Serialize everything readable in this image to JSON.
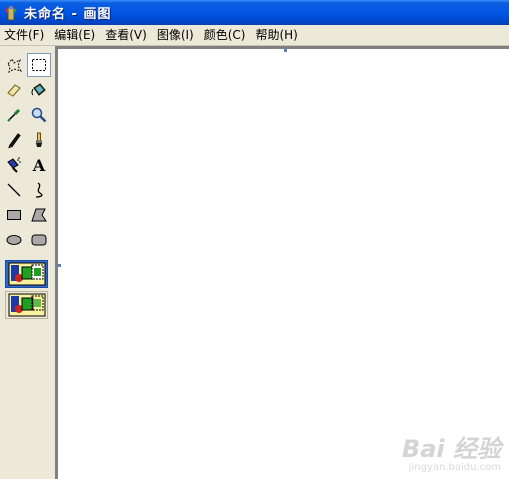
{
  "window": {
    "title": "未命名 - 画图"
  },
  "menu": [
    "文件(F)",
    "编辑(E)",
    "查看(V)",
    "图像(I)",
    "颜色(C)",
    "帮助(H)"
  ],
  "tools": [
    {
      "name": "free-form-select-icon",
      "selected": false
    },
    {
      "name": "rect-select-icon",
      "selected": true
    },
    {
      "name": "eraser-icon",
      "selected": false
    },
    {
      "name": "fill-bucket-icon",
      "selected": false
    },
    {
      "name": "color-picker-icon",
      "selected": false
    },
    {
      "name": "magnifier-icon",
      "selected": false
    },
    {
      "name": "pencil-icon",
      "selected": false
    },
    {
      "name": "brush-icon",
      "selected": false
    },
    {
      "name": "airbrush-icon",
      "selected": false
    },
    {
      "name": "text-icon",
      "selected": false,
      "glyph": "A"
    },
    {
      "name": "line-icon",
      "selected": false
    },
    {
      "name": "curve-icon",
      "selected": false
    },
    {
      "name": "rectangle-icon",
      "selected": false
    },
    {
      "name": "polygon-icon",
      "selected": false
    },
    {
      "name": "ellipse-icon",
      "selected": false
    },
    {
      "name": "rounded-rect-icon",
      "selected": false
    }
  ],
  "selection_options": [
    {
      "name": "opaque-selection-option",
      "selected": true
    },
    {
      "name": "transparent-selection-option",
      "selected": false
    }
  ],
  "watermark": {
    "main": "Bai 经验",
    "sub": "jingyan.baidu.com"
  }
}
